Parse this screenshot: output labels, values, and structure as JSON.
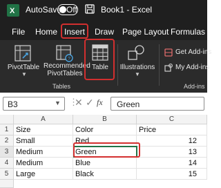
{
  "titlebar": {
    "autosave_label": "AutoSave",
    "autosave_state": "Off",
    "document_title": "Book1 - Excel"
  },
  "menu": {
    "tabs": [
      "File",
      "Home",
      "Insert",
      "Draw",
      "Page Layout",
      "Formulas"
    ],
    "active_tab": "Insert"
  },
  "ribbon": {
    "pivot_table": "PivotTable",
    "recommended_line1": "Recommended",
    "recommended_line2": "PivotTables",
    "table": "Table",
    "illustrations": "Illustrations",
    "get_addins": "Get Add-ins",
    "my_addins": "My Add-ins",
    "group_tables": "Tables",
    "group_addins": "Add-ins"
  },
  "formula_bar": {
    "name_box": "B3",
    "fx": "fx",
    "value": "Green"
  },
  "grid": {
    "columns": [
      "A",
      "B",
      "C"
    ],
    "rows": [
      {
        "num": "1",
        "a": "Size",
        "b": "Color",
        "c": "Price"
      },
      {
        "num": "2",
        "a": "Small",
        "b": "Red",
        "c": "12"
      },
      {
        "num": "3",
        "a": "Medium",
        "b": "Green",
        "c": "13"
      },
      {
        "num": "4",
        "a": "Medium",
        "b": "Blue",
        "c": "14"
      },
      {
        "num": "5",
        "a": "Large",
        "b": "Black",
        "c": "15"
      }
    ]
  },
  "colors": {
    "brand": "#217346",
    "highlight": "#d32f2f",
    "titlebar": "#1f1f1f",
    "ribbon": "#2b2b2b"
  }
}
